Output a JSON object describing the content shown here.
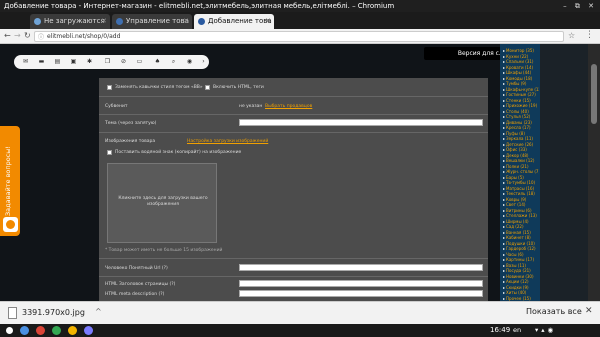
{
  "window": {
    "title": "Добавление товара - Интернет-магазин - elitmebli.net,элитмебель,элитная мебель,елітмеблі. – Chromium",
    "controls": "–  ⧉  ✕"
  },
  "tabs": [
    {
      "label": "Не загружаются"
    },
    {
      "label": "Управление това"
    },
    {
      "label": "Добавление това"
    }
  ],
  "address_bar": {
    "url": "elitmebli.net/shop/0/add"
  },
  "accessibility": {
    "label": "Версия для слабовидящих"
  },
  "form": {
    "replace_quotes_label": "Заменять кавычки стиля тегом «ВВ»",
    "html_label": "Включить HTML, теги",
    "subsection_label": "Субвенит",
    "not_specified": "не указан",
    "choose_link": "Выбрать продавцов",
    "subject_label": "Тема (через запятую)",
    "images_label": "Изображения товара",
    "images_settings_link": "Настройка загрузки изображений",
    "watermark_label": "Поставить водяной знак (копирайт) на изображение",
    "upload_text": "Кликните здесь для загрузки вашего изображения",
    "max_images_note": "* Товар может иметь не больше 15 изображений",
    "friendly_url_label": "Человеко Понятный Url (?)",
    "html_title_label": "HTML Заголовок страницы (?)",
    "html_meta_label": "HTML meta description (?)"
  },
  "feedback": {
    "label": "Задавайте вопросы!"
  },
  "categories": [
    "Монитор (35)",
    "Кухни (22)",
    "Спальни (31)",
    "Кровати (14)",
    "Шкафы (44)",
    "Комоды (18)",
    "Тумбы (9)",
    "Шкафы-купе (12)",
    "Гостиные (27)",
    "Стенки (15)",
    "Прихожие (19)",
    "Столы (40)",
    "Стулья (52)",
    "Диваны (23)",
    "Кресла (17)",
    "Пуфы (8)",
    "Зеркала (11)",
    "Детские (26)",
    "Офис (33)",
    "Декор (48)",
    "Вешалки (12)",
    "Полки (21)",
    "Журн. столы (7)",
    "Бары (5)",
    "Тв-тумбы (10)",
    "Матрасы (16)",
    "Текстиль (18)",
    "Ковры (9)",
    "Свет (14)",
    "Витрины (6)",
    "Стеллажи (13)",
    "Ширмы (4)",
    "Сад (22)",
    "Ванная (15)",
    "Кабинет (8)",
    "Подушки (10)",
    "Гардероб (12)",
    "Часы (6)",
    "Картины (17)",
    "Вазы (11)",
    "Посуда (21)",
    "Новинки (30)",
    "Акции (12)",
    "Скидки (9)",
    "Хиты (40)",
    "Прочее (15)"
  ],
  "downloads": {
    "filename": "3391.970x0.jpg",
    "show_all": "Показать все"
  },
  "shelf": {
    "time": "16:49",
    "lang": "en"
  }
}
